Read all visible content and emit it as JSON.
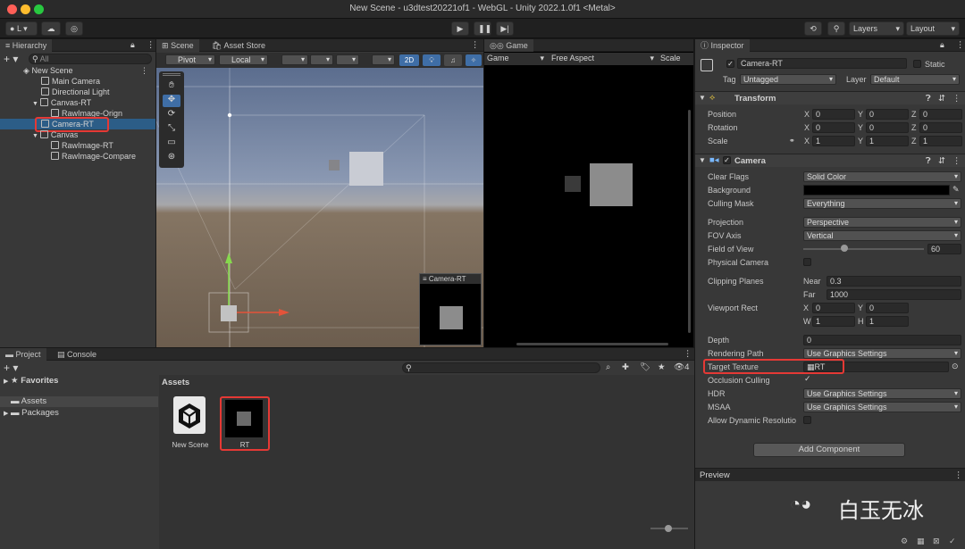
{
  "window": {
    "title": "New Scene - u3dtest20221of1 - WebGL - Unity 2022.1.0f1 <Metal>"
  },
  "toolbar": {
    "account_label": "L",
    "layers_label": "Layers",
    "layout_label": "Layout"
  },
  "hierarchy": {
    "tab_label": "Hierarchy",
    "search_placeholder": "All",
    "items": [
      {
        "label": "New Scene"
      },
      {
        "label": "Main Camera"
      },
      {
        "label": "Directional Light"
      },
      {
        "label": "Canvas-RT"
      },
      {
        "label": "RawImage-Orign"
      },
      {
        "label": "Camera-RT"
      },
      {
        "label": "Canvas"
      },
      {
        "label": "RawImage-RT"
      },
      {
        "label": "RawImage-Compare"
      }
    ]
  },
  "scene": {
    "tab_label": "Scene",
    "asset_store_label": "Asset Store",
    "pivot_label": "Pivot",
    "local_label": "Local",
    "mode_2d_label": "2D",
    "camera_preview_label": "Camera-RT"
  },
  "game": {
    "tab_label": "Game",
    "display_label": "Game",
    "aspect_label": "Free Aspect",
    "scale_label": "Scale"
  },
  "inspector": {
    "tab_label": "Inspector",
    "object_name": "Camera-RT",
    "static_label": "Static",
    "tag_label": "Tag",
    "tag_value": "Untagged",
    "layer_label": "Layer",
    "layer_value": "Default",
    "transform": {
      "header": "Transform",
      "position_label": "Position",
      "rotation_label": "Rotation",
      "scale_label": "Scale",
      "position": [
        "0",
        "0",
        "0"
      ],
      "rotation": [
        "0",
        "0",
        "0"
      ],
      "scale": [
        "1",
        "1",
        "1"
      ],
      "x": "X",
      "y": "Y",
      "z": "Z"
    },
    "camera": {
      "header": "Camera",
      "clear_flags_label": "Clear Flags",
      "clear_flags_value": "Solid Color",
      "background_label": "Background",
      "culling_mask_label": "Culling Mask",
      "culling_mask_value": "Everything",
      "projection_label": "Projection",
      "projection_value": "Perspective",
      "fov_axis_label": "FOV Axis",
      "fov_axis_value": "Vertical",
      "fov_label": "Field of View",
      "fov_value": "60",
      "physical_label": "Physical Camera",
      "clipping_label": "Clipping Planes",
      "near_label": "Near",
      "near_value": "0.3",
      "far_label": "Far",
      "far_value": "1000",
      "viewport_label": "Viewport Rect",
      "vp_x_label": "X",
      "vp_x": "0",
      "vp_y_label": "Y",
      "vp_y": "0",
      "vp_w_label": "W",
      "vp_w": "1",
      "vp_h_label": "H",
      "vp_h": "1",
      "depth_label": "Depth",
      "depth_value": "0",
      "rendering_path_label": "Rendering Path",
      "rendering_path_value": "Use Graphics Settings",
      "target_texture_label": "Target Texture",
      "target_texture_value": "RT",
      "occlusion_label": "Occlusion Culling",
      "hdr_label": "HDR",
      "hdr_value": "Use Graphics Settings",
      "msaa_label": "MSAA",
      "msaa_value": "Use Graphics Settings",
      "dynamic_res_label": "Allow Dynamic Resolutio"
    },
    "add_component_label": "Add Component",
    "preview_label": "Preview"
  },
  "project": {
    "tab_label": "Project",
    "console_tab_label": "Console",
    "favorites_label": "Favorites",
    "assets_label": "Assets",
    "packages_label": "Packages",
    "assets_header": "Assets",
    "hidden_count": "4",
    "files": [
      {
        "label": "New Scene"
      },
      {
        "label": "RT"
      }
    ]
  },
  "watermark": {
    "text": "白玉无冰"
  },
  "colors": {
    "accent_red": "#e53935",
    "selection": "#2c5d87"
  }
}
